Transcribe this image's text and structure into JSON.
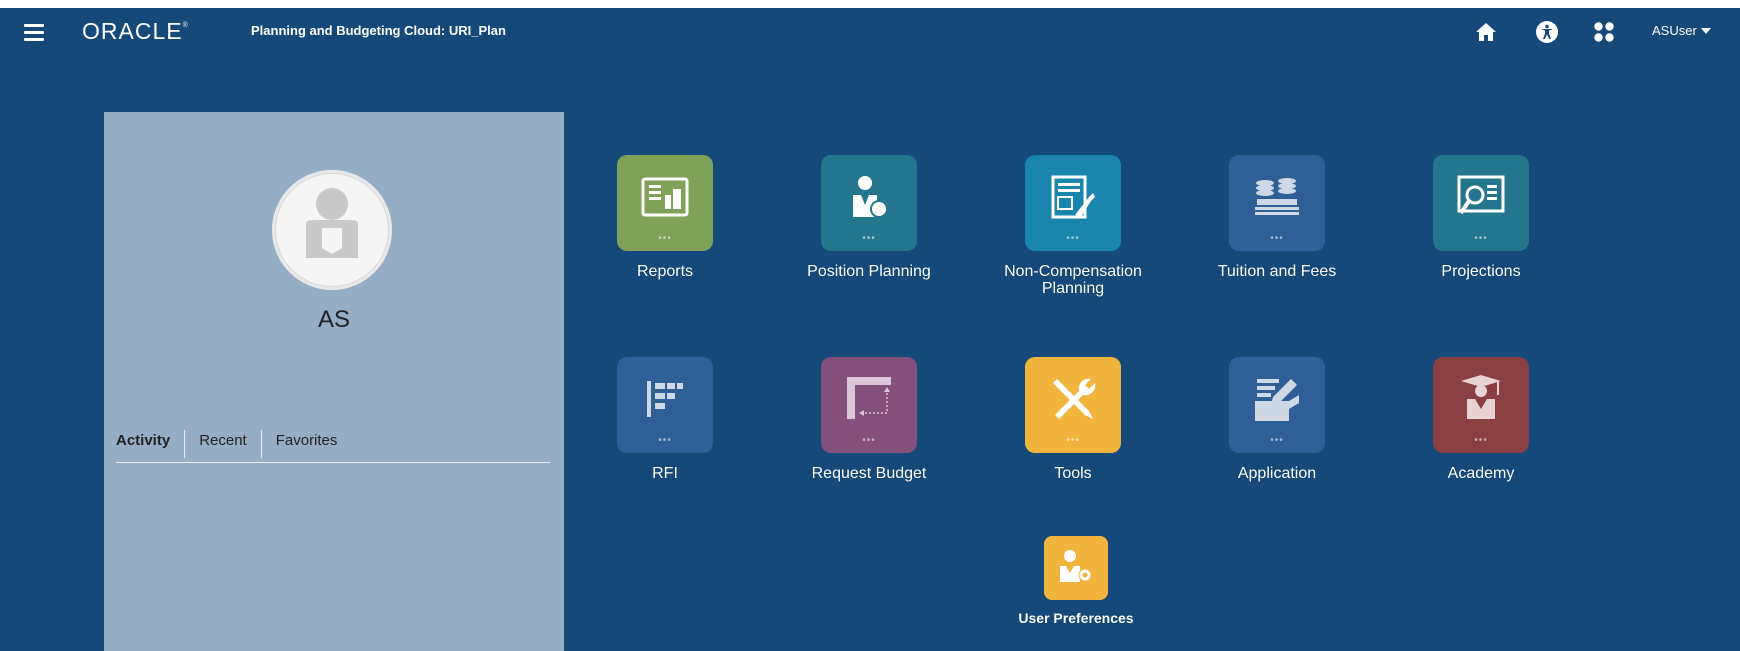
{
  "header": {
    "brand": "ORACLE",
    "app_title": "Planning and Budgeting Cloud: URI_Plan",
    "user": "ASUser",
    "icons": [
      "menu-icon",
      "home-icon",
      "accessibility-icon",
      "navigator-icon",
      "caret-down-icon"
    ]
  },
  "profile": {
    "initials": "AS",
    "tabs": [
      "Activity",
      "Recent",
      "Favorites"
    ],
    "active_tab": "Activity"
  },
  "tiles": [
    {
      "label": "Reports",
      "color": "#7fa158",
      "icon": "reports-icon"
    },
    {
      "label": "Position Planning",
      "color": "#23768b",
      "icon": "position-planning-icon"
    },
    {
      "label": "Non-Compensation Planning",
      "color": "#1a86ad",
      "icon": "non-compensation-icon"
    },
    {
      "label": "Tuition and Fees",
      "color": "#2e5f97",
      "icon": "tuition-icon"
    },
    {
      "label": "Projections",
      "color": "#23768b",
      "icon": "projections-icon"
    },
    {
      "label": "RFI",
      "color": "#2e5f97",
      "icon": "rfi-icon"
    },
    {
      "label": "Request Budget",
      "color": "#83507c",
      "icon": "request-budget-icon"
    },
    {
      "label": "Tools",
      "color": "#f1b43d",
      "icon": "tools-icon"
    },
    {
      "label": "Application",
      "color": "#2e5f97",
      "icon": "application-icon"
    },
    {
      "label": "Academy",
      "color": "#8a3f42",
      "icon": "academy-icon"
    },
    {
      "label": "User Preferences",
      "color": "#f1b43d",
      "icon": "user-preferences-icon"
    }
  ],
  "colors": {
    "background": "#15497a",
    "profile_panel": "#95aec6"
  }
}
